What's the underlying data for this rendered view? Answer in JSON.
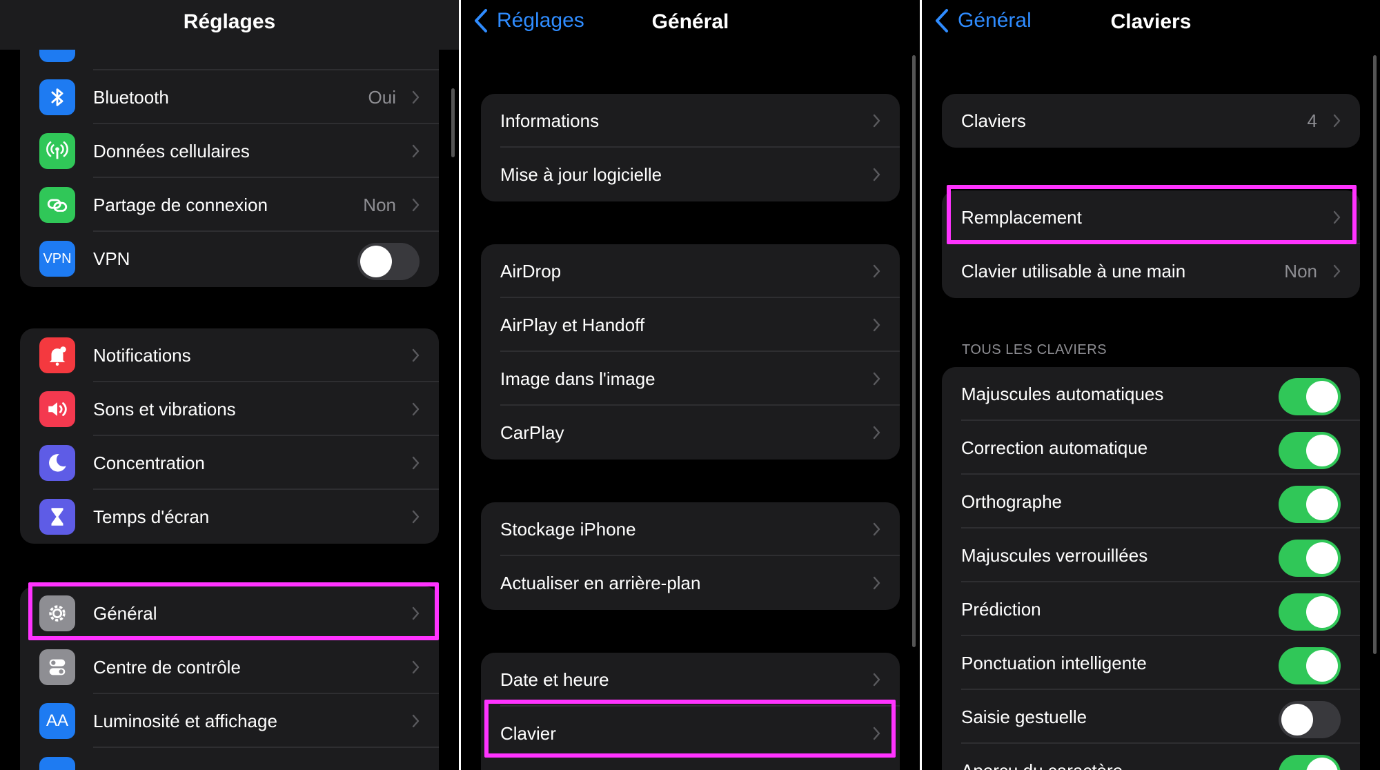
{
  "colors": {
    "accent": "#2f8cff",
    "highlight": "#ff33ff",
    "toggle_on": "#30c758",
    "icon_bluetooth": "#1e7bf2",
    "icon_cellular": "#30c758",
    "icon_hotspot": "#30c758",
    "icon_vpn": "#1e7bf2",
    "icon_notifications": "#f4393f",
    "icon_sounds": "#f4394f",
    "icon_focus": "#5e5ce6",
    "icon_screentime": "#5e5ce6",
    "icon_general": "#8e8e93",
    "icon_control": "#8e8e93",
    "icon_display": "#1e7bf2"
  },
  "panel1": {
    "title": "Réglages",
    "group1": [
      {
        "label": "Bluetooth",
        "value": "Oui",
        "icon": "bluetooth-icon"
      },
      {
        "label": "Données cellulaires",
        "value": "",
        "icon": "antenna-icon"
      },
      {
        "label": "Partage de connexion",
        "value": "Non",
        "icon": "hotspot-link-icon"
      },
      {
        "label": "VPN",
        "value": "",
        "icon": "vpn-icon",
        "icon_text": "VPN",
        "toggle": false
      }
    ],
    "group2": [
      {
        "label": "Notifications",
        "icon": "bell-icon"
      },
      {
        "label": "Sons et vibrations",
        "icon": "speaker-icon"
      },
      {
        "label": "Concentration",
        "icon": "moon-icon"
      },
      {
        "label": "Temps d'écran",
        "icon": "hourglass-icon"
      }
    ],
    "group3": [
      {
        "label": "Général",
        "icon": "gear-icon"
      },
      {
        "label": "Centre de contrôle",
        "icon": "switches-icon"
      },
      {
        "label": "Luminosité et affichage",
        "icon": "text-size-icon",
        "icon_text": "AA"
      }
    ]
  },
  "panel2": {
    "back": "Réglages",
    "title": "Général",
    "group1": [
      "Informations",
      "Mise à jour logicielle"
    ],
    "group2": [
      "AirDrop",
      "AirPlay et Handoff",
      "Image dans l'image",
      "CarPlay"
    ],
    "group3": [
      "Stockage iPhone",
      "Actualiser en arrière-plan"
    ],
    "group4": [
      "Date et heure",
      "Clavier"
    ]
  },
  "panel3": {
    "back": "Général",
    "title": "Claviers",
    "group1": [
      {
        "label": "Claviers",
        "value": "4"
      }
    ],
    "group2": [
      {
        "label": "Remplacement",
        "value": ""
      },
      {
        "label": "Clavier utilisable à une main",
        "value": "Non"
      }
    ],
    "section_header": "TOUS LES CLAVIERS",
    "toggles": [
      {
        "label": "Majuscules automatiques",
        "on": true
      },
      {
        "label": "Correction automatique",
        "on": true
      },
      {
        "label": "Orthographe",
        "on": true
      },
      {
        "label": "Majuscules verrouillées",
        "on": true
      },
      {
        "label": "Prédiction",
        "on": true
      },
      {
        "label": "Ponctuation intelligente",
        "on": true
      },
      {
        "label": "Saisie gestuelle",
        "on": false
      },
      {
        "label": "Aperçu du caractère",
        "on": true
      }
    ]
  }
}
